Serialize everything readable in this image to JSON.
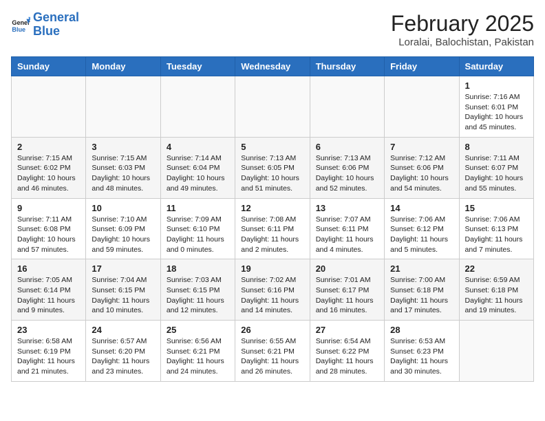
{
  "header": {
    "logo_line1": "General",
    "logo_line2": "Blue",
    "title": "February 2025",
    "subtitle": "Loralai, Balochistan, Pakistan"
  },
  "weekdays": [
    "Sunday",
    "Monday",
    "Tuesday",
    "Wednesday",
    "Thursday",
    "Friday",
    "Saturday"
  ],
  "weeks": [
    [
      {
        "day": "",
        "info": ""
      },
      {
        "day": "",
        "info": ""
      },
      {
        "day": "",
        "info": ""
      },
      {
        "day": "",
        "info": ""
      },
      {
        "day": "",
        "info": ""
      },
      {
        "day": "",
        "info": ""
      },
      {
        "day": "1",
        "info": "Sunrise: 7:16 AM\nSunset: 6:01 PM\nDaylight: 10 hours\nand 45 minutes."
      }
    ],
    [
      {
        "day": "2",
        "info": "Sunrise: 7:15 AM\nSunset: 6:02 PM\nDaylight: 10 hours\nand 46 minutes."
      },
      {
        "day": "3",
        "info": "Sunrise: 7:15 AM\nSunset: 6:03 PM\nDaylight: 10 hours\nand 48 minutes."
      },
      {
        "day": "4",
        "info": "Sunrise: 7:14 AM\nSunset: 6:04 PM\nDaylight: 10 hours\nand 49 minutes."
      },
      {
        "day": "5",
        "info": "Sunrise: 7:13 AM\nSunset: 6:05 PM\nDaylight: 10 hours\nand 51 minutes."
      },
      {
        "day": "6",
        "info": "Sunrise: 7:13 AM\nSunset: 6:06 PM\nDaylight: 10 hours\nand 52 minutes."
      },
      {
        "day": "7",
        "info": "Sunrise: 7:12 AM\nSunset: 6:06 PM\nDaylight: 10 hours\nand 54 minutes."
      },
      {
        "day": "8",
        "info": "Sunrise: 7:11 AM\nSunset: 6:07 PM\nDaylight: 10 hours\nand 55 minutes."
      }
    ],
    [
      {
        "day": "9",
        "info": "Sunrise: 7:11 AM\nSunset: 6:08 PM\nDaylight: 10 hours\nand 57 minutes."
      },
      {
        "day": "10",
        "info": "Sunrise: 7:10 AM\nSunset: 6:09 PM\nDaylight: 10 hours\nand 59 minutes."
      },
      {
        "day": "11",
        "info": "Sunrise: 7:09 AM\nSunset: 6:10 PM\nDaylight: 11 hours\nand 0 minutes."
      },
      {
        "day": "12",
        "info": "Sunrise: 7:08 AM\nSunset: 6:11 PM\nDaylight: 11 hours\nand 2 minutes."
      },
      {
        "day": "13",
        "info": "Sunrise: 7:07 AM\nSunset: 6:11 PM\nDaylight: 11 hours\nand 4 minutes."
      },
      {
        "day": "14",
        "info": "Sunrise: 7:06 AM\nSunset: 6:12 PM\nDaylight: 11 hours\nand 5 minutes."
      },
      {
        "day": "15",
        "info": "Sunrise: 7:06 AM\nSunset: 6:13 PM\nDaylight: 11 hours\nand 7 minutes."
      }
    ],
    [
      {
        "day": "16",
        "info": "Sunrise: 7:05 AM\nSunset: 6:14 PM\nDaylight: 11 hours\nand 9 minutes."
      },
      {
        "day": "17",
        "info": "Sunrise: 7:04 AM\nSunset: 6:15 PM\nDaylight: 11 hours\nand 10 minutes."
      },
      {
        "day": "18",
        "info": "Sunrise: 7:03 AM\nSunset: 6:15 PM\nDaylight: 11 hours\nand 12 minutes."
      },
      {
        "day": "19",
        "info": "Sunrise: 7:02 AM\nSunset: 6:16 PM\nDaylight: 11 hours\nand 14 minutes."
      },
      {
        "day": "20",
        "info": "Sunrise: 7:01 AM\nSunset: 6:17 PM\nDaylight: 11 hours\nand 16 minutes."
      },
      {
        "day": "21",
        "info": "Sunrise: 7:00 AM\nSunset: 6:18 PM\nDaylight: 11 hours\nand 17 minutes."
      },
      {
        "day": "22",
        "info": "Sunrise: 6:59 AM\nSunset: 6:18 PM\nDaylight: 11 hours\nand 19 minutes."
      }
    ],
    [
      {
        "day": "23",
        "info": "Sunrise: 6:58 AM\nSunset: 6:19 PM\nDaylight: 11 hours\nand 21 minutes."
      },
      {
        "day": "24",
        "info": "Sunrise: 6:57 AM\nSunset: 6:20 PM\nDaylight: 11 hours\nand 23 minutes."
      },
      {
        "day": "25",
        "info": "Sunrise: 6:56 AM\nSunset: 6:21 PM\nDaylight: 11 hours\nand 24 minutes."
      },
      {
        "day": "26",
        "info": "Sunrise: 6:55 AM\nSunset: 6:21 PM\nDaylight: 11 hours\nand 26 minutes."
      },
      {
        "day": "27",
        "info": "Sunrise: 6:54 AM\nSunset: 6:22 PM\nDaylight: 11 hours\nand 28 minutes."
      },
      {
        "day": "28",
        "info": "Sunrise: 6:53 AM\nSunset: 6:23 PM\nDaylight: 11 hours\nand 30 minutes."
      },
      {
        "day": "",
        "info": ""
      }
    ]
  ]
}
